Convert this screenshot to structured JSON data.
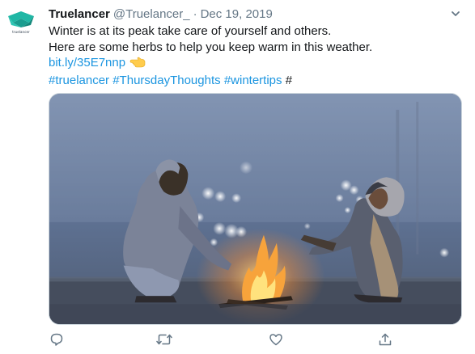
{
  "tweet": {
    "display_name": "Truelancer",
    "handle": "@Truelancer_",
    "separator": "·",
    "date": "Dec 19, 2019",
    "avatar_text": "truelancer",
    "text_line_1": "Winter is at its peak take care of yourself and others.",
    "text_line_2": "Here are some herbs to help you keep warm in this weather.",
    "link": "bit.ly/35E7nnp",
    "hashtags": [
      "#truelancer",
      "#ThursdayThoughts",
      "#wintertips"
    ],
    "trailing_symbol": "#"
  },
  "icons": {
    "caret": "chevron-down-icon",
    "pointing_hand": "pointing-left-hand-emoji",
    "reply": "reply-icon",
    "retweet": "retweet-icon",
    "like": "heart-icon",
    "share": "share-icon"
  },
  "colors": {
    "brand_link": "#1b95e0",
    "text": "#14171a",
    "muted": "#657786",
    "avatar_teal": "#22b8a6"
  }
}
